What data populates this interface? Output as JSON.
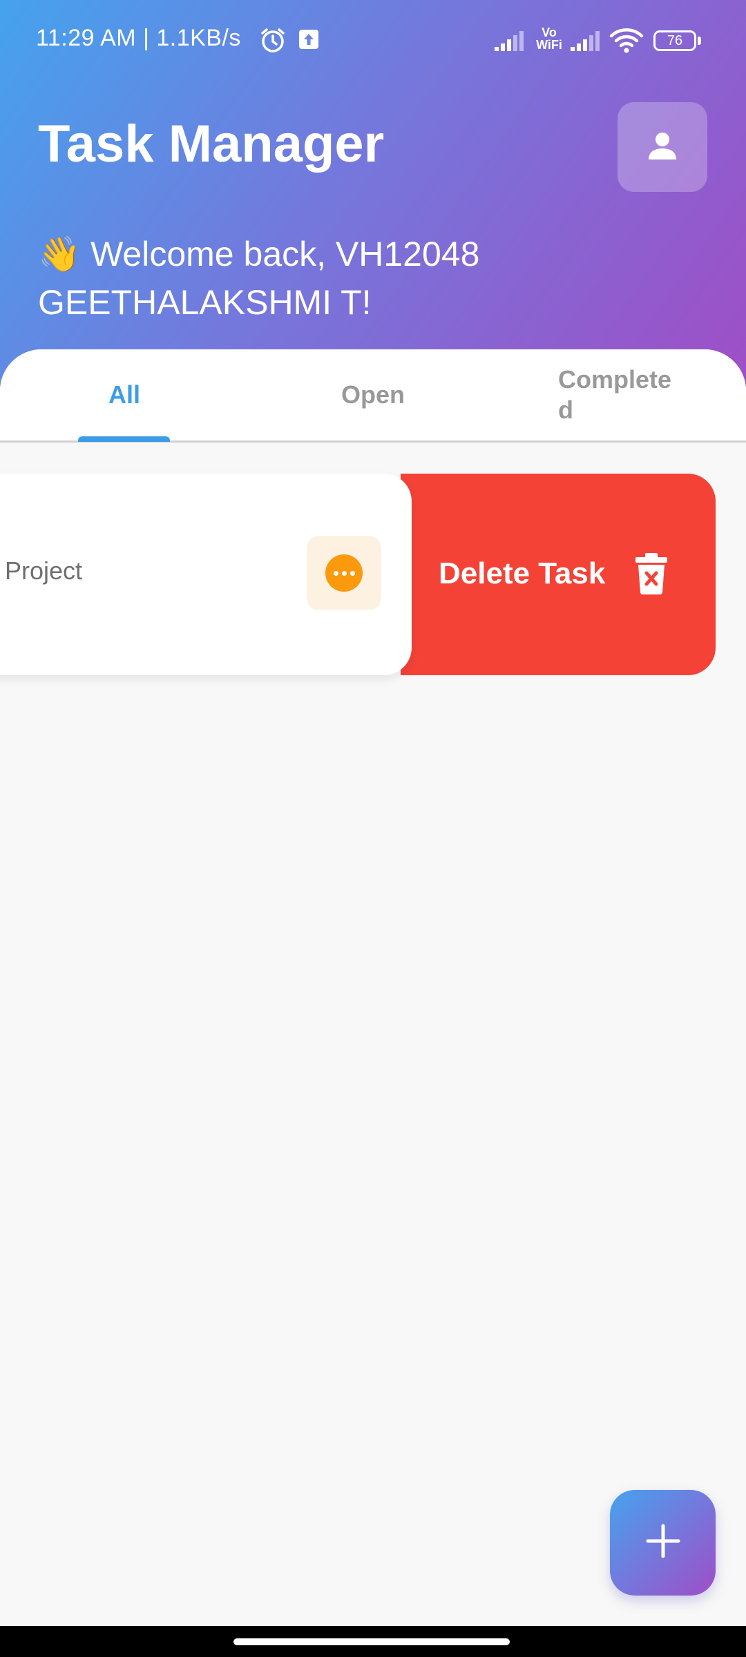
{
  "status_bar": {
    "time": "11:29 AM | 1.1KB/s",
    "network_label": "Vo WiFi",
    "battery": "76"
  },
  "header": {
    "title": "Task Manager",
    "welcome": "👋 Welcome back, VH12048 GEETHALAKSHMI T!"
  },
  "tabs": [
    {
      "label": "All",
      "selected": true
    },
    {
      "label": "Open",
      "selected": false
    },
    {
      "label": "Completed",
      "selected": false
    }
  ],
  "tasks": [
    {
      "title": "Project",
      "status_icon": "more-horiz-icon",
      "swipe_action": "Delete Task"
    }
  ],
  "colors": {
    "header_gradient": [
      "#45a3ee",
      "#9f4ec6"
    ],
    "tab_active": "#3b9de8",
    "delete": "#f44237",
    "status_open": "#fb9a0d"
  }
}
